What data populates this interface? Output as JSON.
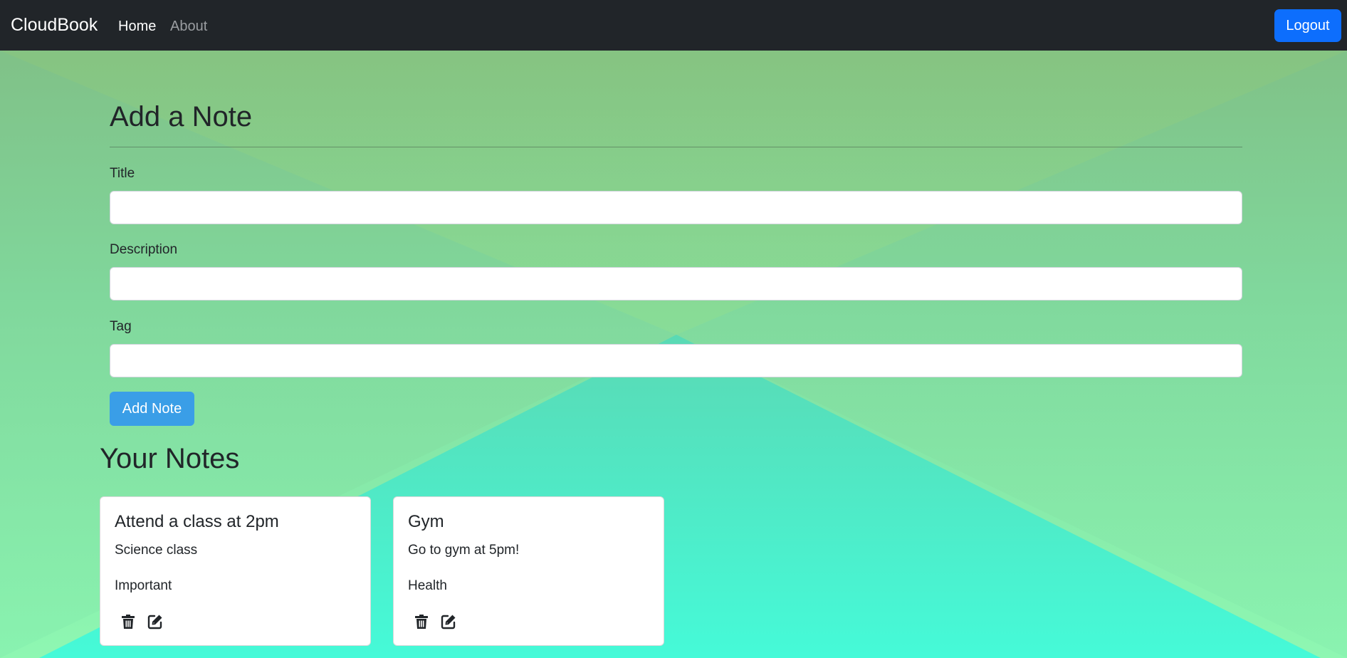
{
  "navbar": {
    "brand": "CloudBook",
    "links": [
      {
        "label": "Home",
        "active": true
      },
      {
        "label": "About",
        "active": false
      }
    ],
    "logout_label": "Logout"
  },
  "add_note": {
    "heading": "Add a Note",
    "fields": {
      "title": {
        "label": "Title",
        "value": ""
      },
      "description": {
        "label": "Description",
        "value": ""
      },
      "tag": {
        "label": "Tag",
        "value": ""
      }
    },
    "submit_label": "Add Note"
  },
  "notes_section": {
    "heading": "Your Notes",
    "notes": [
      {
        "title": "Attend a class at 2pm",
        "description": "Science class",
        "tag": "Important",
        "icons": [
          "trash-icon",
          "edit-icon"
        ]
      },
      {
        "title": "Gym",
        "description": "Go to gym at 5pm!",
        "tag": "Health",
        "icons": [
          "trash-icon",
          "edit-icon"
        ]
      }
    ]
  },
  "colors": {
    "navbar_bg": "#212529",
    "primary_button": "#0d6efd",
    "add_button": "#3a9ee7",
    "background_top": "#86c07e",
    "background_bottom": "#48f7d6"
  }
}
